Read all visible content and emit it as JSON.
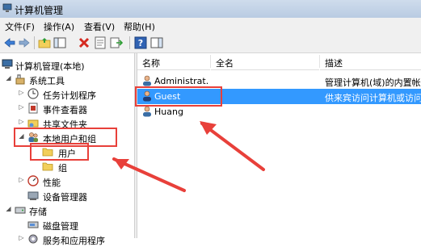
{
  "window": {
    "title": "计算机管理"
  },
  "menu": [
    "文件(F)",
    "操作(A)",
    "查看(V)",
    "帮助(H)"
  ],
  "tree": {
    "root": "计算机管理(本地)",
    "system_tools": "系统工具",
    "task_scheduler": "任务计划程序",
    "event_viewer": "事件查看器",
    "shared_folders": "共享文件夹",
    "local_users_groups": "本地用户和组",
    "users": "用户",
    "groups": "组",
    "performance": "性能",
    "device_manager": "设备管理器",
    "storage": "存储",
    "disk_management": "磁盘管理",
    "services_apps": "服务和应用程序"
  },
  "list": {
    "columns": [
      "名称",
      "全名",
      "描述"
    ],
    "rows": [
      {
        "name": "Administrat...",
        "fullname": "",
        "description": "管理计算机(域)的内置帐户",
        "selected": false
      },
      {
        "name": "Guest",
        "fullname": "",
        "description": "供来宾访问计算机或访问域",
        "selected": true
      },
      {
        "name": "Huang",
        "fullname": "",
        "description": "",
        "selected": false
      }
    ]
  },
  "colors": {
    "selection": "#3399ff",
    "annotation": "#e8403a"
  }
}
